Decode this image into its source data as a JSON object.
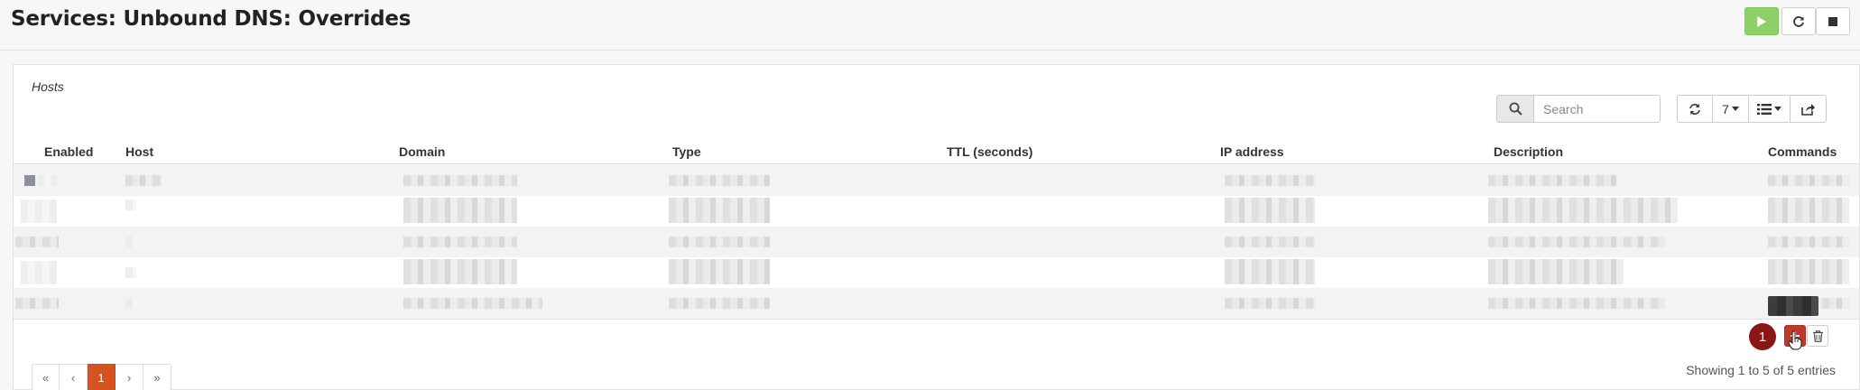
{
  "page": {
    "title": "Services: Unbound DNS: Overrides"
  },
  "service_controls": {
    "start_icon": "play-icon",
    "restart_icon": "refresh-icon",
    "stop_icon": "stop-icon"
  },
  "panel": {
    "title": "Hosts"
  },
  "toolbar": {
    "search_placeholder": "Search",
    "rows_per_page": "7",
    "refresh_icon": "refresh-icon",
    "columns_icon": "list-icon",
    "export_icon": "export-icon"
  },
  "grid": {
    "columns": [
      "Enabled",
      "Host",
      "Domain",
      "Type",
      "TTL (seconds)",
      "IP address",
      "Description",
      "Commands"
    ],
    "rows_count_label": "5 rows (contents obscured)"
  },
  "commands": {
    "badge": "1",
    "add_icon": "plus-icon",
    "delete_icon": "trash-icon"
  },
  "pagination": {
    "first": "«",
    "prev": "‹",
    "current": "1",
    "next": "›",
    "last": "»"
  },
  "footer": {
    "info": "Showing 1 to 5 of 5 entries"
  },
  "colors": {
    "start_button": "#8fcf6a",
    "active_page": "#d4531f",
    "badge": "#8b1616",
    "add_button": "#c0392b"
  }
}
